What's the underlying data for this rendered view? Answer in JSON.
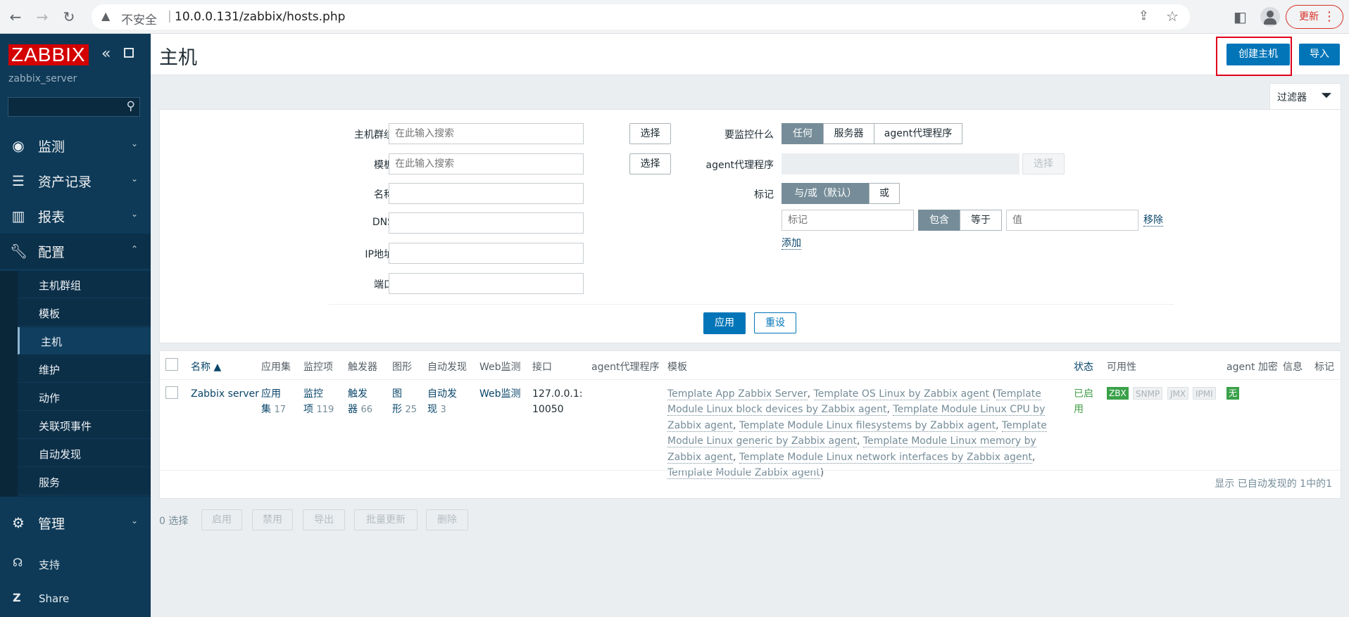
{
  "browser": {
    "insecure_label": "不安全",
    "separator": "|",
    "url": "10.0.0.131/zabbix/hosts.php",
    "update_label": "更新"
  },
  "sidebar": {
    "logo": "ZABBIX",
    "server_name": "zabbix_server",
    "menu": [
      {
        "label": "监测",
        "icon": "eye-icon"
      },
      {
        "label": "资产记录",
        "icon": "list-icon"
      },
      {
        "label": "报表",
        "icon": "bar-chart-icon"
      },
      {
        "label": "配置",
        "icon": "wrench-icon"
      },
      {
        "label": "管理",
        "icon": "gear-icon"
      }
    ],
    "submenu": [
      "主机群组",
      "模板",
      "主机",
      "维护",
      "动作",
      "关联项事件",
      "自动发现",
      "服务"
    ],
    "footer": [
      {
        "label": "支持",
        "icon": "headset-icon"
      },
      {
        "label": "Share",
        "icon": "share-z-icon"
      }
    ]
  },
  "header": {
    "title": "主机",
    "create_host": "创建主机",
    "import": "导入"
  },
  "filter": {
    "tab_label": "过滤器",
    "host_groups_label": "主机群组",
    "host_groups_placeholder": "在此输入搜索",
    "templates_label": "模板",
    "templates_placeholder": "在此输入搜索",
    "select_label": "选择",
    "name_label": "名称",
    "dns_label": "DNS",
    "ip_label": "IP地址",
    "port_label": "端口",
    "monitored_by_label": "要监控什么",
    "monitored_by_options": [
      "任何",
      "服务器",
      "agent代理程序"
    ],
    "proxy_label": "agent代理程序",
    "tags_label": "标记",
    "tags_eval_options": [
      "与/或（默认）",
      "或"
    ],
    "tag_placeholder": "标记",
    "tag_operators": [
      "包含",
      "等于"
    ],
    "value_placeholder": "值",
    "remove_label": "移除",
    "add_label": "添加",
    "apply_label": "应用",
    "reset_label": "重设"
  },
  "table": {
    "columns": {
      "name": "名称 ▲",
      "applications": "应用集",
      "items": "监控项",
      "triggers": "触发器",
      "graphs": "图形",
      "discovery": "自动发现",
      "web": "Web监测",
      "interface": "接口",
      "proxy": "agent代理程序",
      "templates": "模板",
      "status": "状态",
      "availability": "可用性",
      "encryption": "agent 加密",
      "info": "信息",
      "tags": "标记"
    },
    "rows": [
      {
        "name": "Zabbix server",
        "applications_1": "应用",
        "applications_2": "集",
        "applications_count": "17",
        "items_1": "监控",
        "items_2": "项",
        "items_count": "119",
        "triggers_1": "触发",
        "triggers_2": "器",
        "triggers_count": "66",
        "graphs_1": "图",
        "graphs_2": "形",
        "graphs_count": "25",
        "discovery_1": "自动发",
        "discovery_2": "现",
        "discovery_count": "3",
        "web": "Web监测",
        "interface_1": "127.0.0.1:",
        "interface_2": "10050",
        "templates": {
          "t1": "Template App Zabbix Server",
          "t2": "Template OS Linux by Zabbix agent",
          "t3": "Template Module Linux block devices by Zabbix agent",
          "t4": "Template Module Linux CPU by Zabbix agent",
          "t5": "Template Module Linux filesystems by Zabbix agent",
          "t6": "Template Module Linux generic by Zabbix agent",
          "t7": "Template Module Linux memory by Zabbix agent",
          "t8": "Template Module Linux network interfaces by Zabbix agent",
          "t9": "Template Module Zabbix agent"
        },
        "status_1": "已启",
        "status_2": "用",
        "availability": [
          "ZBX",
          "SNMP",
          "JMX",
          "IPMI"
        ],
        "encryption": "无"
      }
    ],
    "footer": "显示 已自动发现的 1中的1"
  },
  "actions": {
    "selected": "0 选择",
    "buttons": [
      "启用",
      "禁用",
      "导出",
      "批量更新",
      "删除"
    ]
  },
  "colors": {
    "sidebar_bg": "#0e3a58",
    "primary": "#0275b8",
    "logo_red": "#d40000",
    "highlight": "#e0001a",
    "status_green": "#3aa14a"
  }
}
